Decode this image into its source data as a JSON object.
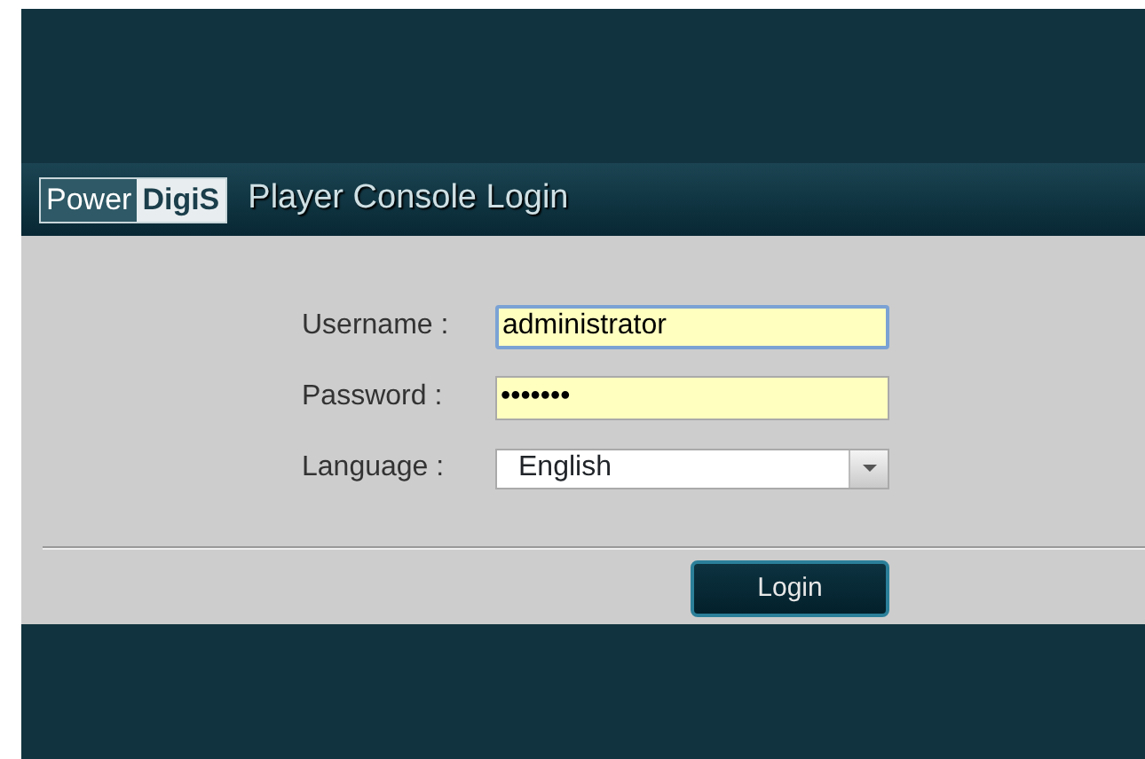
{
  "header": {
    "logo": [
      "Power",
      "DigiS"
    ],
    "title": "Player Console Login"
  },
  "fields": [
    {
      "label": "Username :",
      "kind": "text",
      "value": "administrator",
      "focused": true
    },
    {
      "label": "Password :",
      "kind": "text",
      "value": "•••••••",
      "focused": false
    },
    {
      "label": "Language :",
      "kind": "select",
      "value": "English",
      "focused": false
    }
  ],
  "buttons": [
    "Login"
  ]
}
